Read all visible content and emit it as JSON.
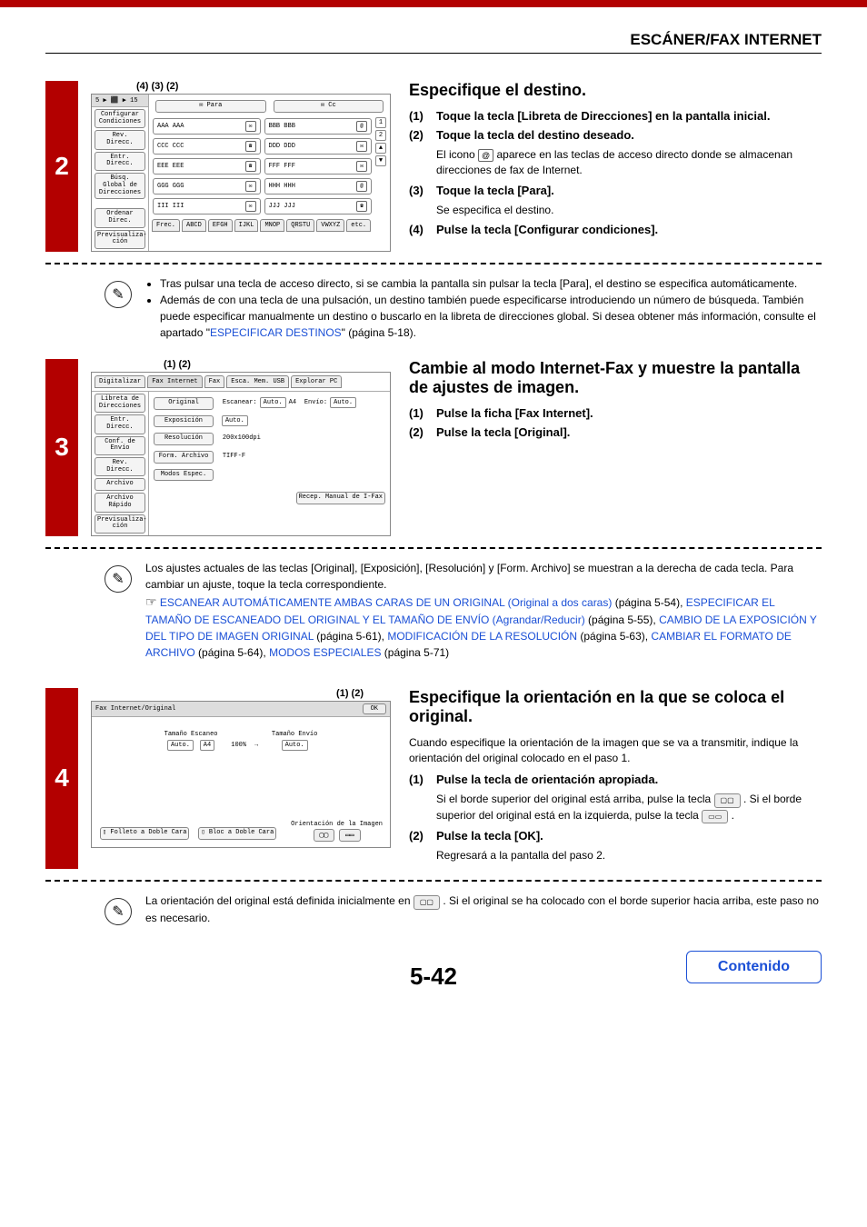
{
  "header": "ESCÁNER/FAX INTERNET",
  "step2": {
    "num": "2",
    "callouts": "(4)    (3)      (2)",
    "title": "Especifique el destino.",
    "items": [
      {
        "n": "(1)",
        "t": "Toque la tecla [Libreta de Direcciones] en la pantalla inicial."
      },
      {
        "n": "(2)",
        "t": "Toque la tecla del destino deseado."
      },
      {
        "n": "(3)",
        "t": "Toque la tecla [Para]."
      },
      {
        "n": "(4)",
        "t": "Pulse la tecla [Configurar condiciones]."
      }
    ],
    "desc2a": "El icono ",
    "desc2b": " aparece en las teclas de acceso directo donde se almacenan direcciones de fax de Internet.",
    "desc3": "Se especifica el destino.",
    "note_b1": "Tras pulsar una tecla de acceso directo, si se cambia la pantalla sin pulsar la tecla [Para], el destino se especifica automáticamente.",
    "note_b2a": "Además de con una tecla de una pulsación, un destino también puede especificarse introduciendo un número de búsqueda. También puede especificar manualmente un destino o buscarlo en la libreta de direcciones global. Si desea obtener más información, consulte el apartado \"",
    "note_link": "ESPECIFICAR DESTINOS",
    "note_b2b": "\" (página 5-18).",
    "ss": {
      "top": "5 ▶ ⬛ ▶ 15",
      "para": "Para",
      "cc": "Cc",
      "side": [
        "Configurar Condiciones",
        "Rev. Direcc.",
        "Entr. Direcc.",
        "Búsq. Global de Direcciones",
        "Ordenar Direc.",
        "Previsualiza-ción"
      ],
      "entries": [
        "AAA AAA",
        "BBB BBB",
        "CCC CCC",
        "DDD DDD",
        "EEE EEE",
        "FFF FFF",
        "GGG GGG",
        "HHH HHH",
        "III III",
        "JJJ JJJ"
      ],
      "pager": [
        "1",
        "2"
      ],
      "tabs": [
        "Frec.",
        "ABCD",
        "EFGH",
        "IJKL",
        "MNOP",
        "QRSTU",
        "VWXYZ",
        "etc."
      ]
    }
  },
  "step3": {
    "num": "3",
    "callouts": "(1)   (2)",
    "title": "Cambie al modo Internet-Fax y muestre la pantalla de ajustes de imagen.",
    "items": [
      {
        "n": "(1)",
        "t": "Pulse la ficha [Fax Internet]."
      },
      {
        "n": "(2)",
        "t": "Pulse la tecla [Original]."
      }
    ],
    "note1": "Los ajustes actuales de las teclas [Original], [Exposición], [Resolución] y [Form. Archivo] se muestran a la derecha de cada tecla. Para cambiar un ajuste, toque la tecla correspondiente.",
    "links": {
      "l1": "ESCANEAR AUTOMÁTICAMENTE AMBAS CARAS DE UN ORIGINAL (Original a dos caras)",
      "p1": " (página 5-54), ",
      "l2": "ESPECIFICAR EL TAMAÑO DE ESCANEADO DEL ORIGINAL Y EL TAMAÑO DE ENVÍO (Agrandar/Reducir)",
      "p2": " (página 5-55), ",
      "l3": "CAMBIO DE LA EXPOSICIÓN Y DEL TIPO DE IMAGEN ORIGINAL",
      "p3": " (página 5-61), ",
      "l4": "MODIFICACIÓN DE LA RESOLUCIÓN",
      "p4": " (página 5-63), ",
      "l5": "CAMBIAR EL FORMATO DE ARCHIVO",
      "p5": " (página 5-64), ",
      "l6": "MODOS ESPECIALES",
      "p6": " (página 5-71)"
    },
    "ss": {
      "tabs": [
        "Digitalizar",
        "Fax Internet",
        "Fax",
        "Esca. Mem. USB",
        "Explorar PC"
      ],
      "side": [
        "Libreta de Direcciones",
        "Entr. Direcc.",
        "Conf. de Envío",
        "Rev. Direcc.",
        "Archivo",
        "Archivo Rápido",
        "Previsualiza-ción"
      ],
      "rows": [
        [
          "Original",
          "Escanear:",
          "Auto.",
          "A4",
          "Envío:",
          "Auto."
        ],
        [
          "Exposición",
          "Auto."
        ],
        [
          "Resolución",
          "200x100dpi"
        ],
        [
          "Form. Archivo",
          "TIFF-F"
        ],
        [
          "Modos Espec."
        ]
      ],
      "footer": "Recep. Manual de I-Fax"
    }
  },
  "step4": {
    "num": "4",
    "callouts": "(1)        (2)",
    "title": "Especifique la orientación en la que se coloca el original.",
    "intro": "Cuando especifique la orientación de la imagen que se va a transmitir, indique la orientación del original colocado en el paso 1.",
    "items": [
      {
        "n": "(1)",
        "t": "Pulse la tecla de orientación apropiada."
      },
      {
        "n": "(2)",
        "t": "Pulse la tecla [OK]."
      }
    ],
    "desc1a": "Si el borde superior del original está arriba, pulse la tecla ",
    "desc1b": " . Si el borde superior del original está en la izquierda, pulse la tecla ",
    "desc1c": " .",
    "desc2": "Regresará a la pantalla del paso 2.",
    "note_a": "La orientación del original está definida inicialmente en ",
    "note_b": " . Si el original se ha colocado con el borde superior hacia arriba, este paso no es necesario.",
    "ss": {
      "hdr": "Fax Internet/Original",
      "ok": "OK",
      "scanlbl": "Tamaño Escaneo",
      "pct": "100%",
      "sendlbl": "Tamaño Envío",
      "auto": "Auto.",
      "a4": "A4",
      "booklet": "Folleto a Doble Cara",
      "block": "Bloc a Doble Cara",
      "orient": "Orientación de la Imagen"
    }
  },
  "pagenum": "5-42",
  "contenido": "Contenido"
}
